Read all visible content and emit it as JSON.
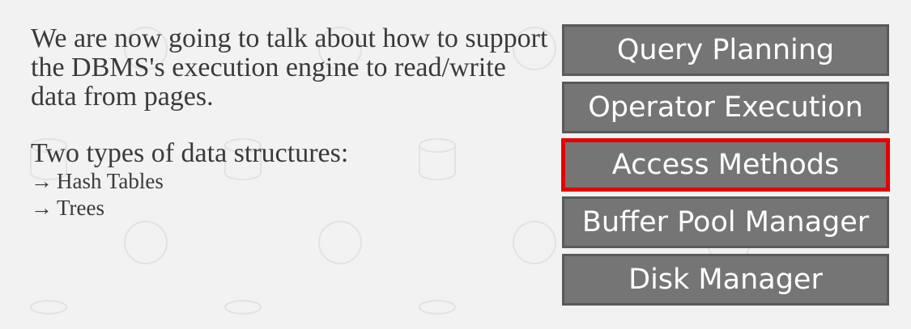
{
  "intro": {
    "paragraph1": "We are now going to talk about how to support the DBMS's execution engine to read/write data from pages.",
    "paragraph2": "Two types of data structures:",
    "bullets": [
      {
        "arrow": "→",
        "text": "Hash Tables"
      },
      {
        "arrow": "→",
        "text": "Trees"
      }
    ]
  },
  "stack": {
    "layers": [
      {
        "label": "Query Planning",
        "highlighted": false
      },
      {
        "label": "Operator Execution",
        "highlighted": false
      },
      {
        "label": "Access Methods",
        "highlighted": true
      },
      {
        "label": "Buffer Pool Manager",
        "highlighted": false
      },
      {
        "label": "Disk Manager",
        "highlighted": false
      }
    ],
    "highlight_color": "#e60000",
    "layer_color": "#757575"
  }
}
